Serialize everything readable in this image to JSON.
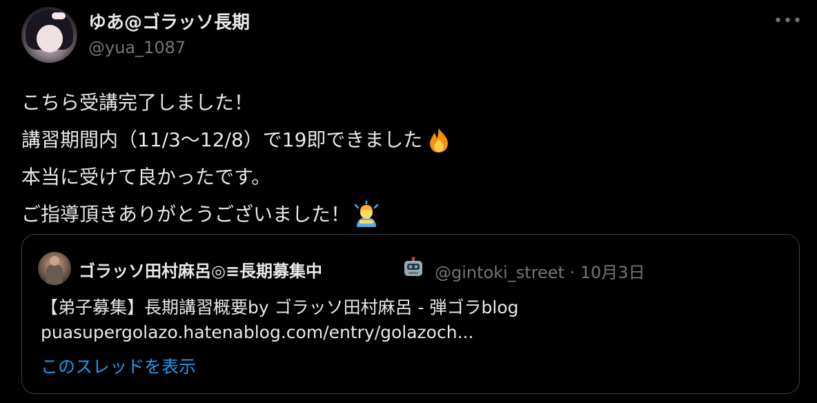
{
  "author": {
    "display_name": "ゆあ@ゴラッソ長期",
    "handle": "@yua_1087",
    "avatar_icon": "profile-photo"
  },
  "more_label": "•••",
  "tweet": {
    "lines": [
      "こちら受講完了しました！",
      "講習期間内（11/3〜12/8）で19即できました",
      "本当に受けて良かったです。",
      "ご指導頂きありがとうございました！"
    ],
    "emojis": [
      "fire-emoji",
      "bowing-person-emoji"
    ]
  },
  "quote": {
    "display_name": "ゴラッソ田村麻呂◎≡長期募集中",
    "name_emoji": "robot-emoji",
    "meta": "@gintoki_street · 10月3日",
    "title": "【弟子募集】長期講習概要by ゴラッソ田村麻呂 - 弾ゴラblog",
    "url": "puasupergolazo.hatenablog.com/entry/golazoch...",
    "show_thread": "このスレッドを表示"
  },
  "colors": {
    "background": "#000000",
    "text": "#e7e9ea",
    "muted": "#71767b",
    "link": "#1d9bf0",
    "border": "#3e4144"
  }
}
